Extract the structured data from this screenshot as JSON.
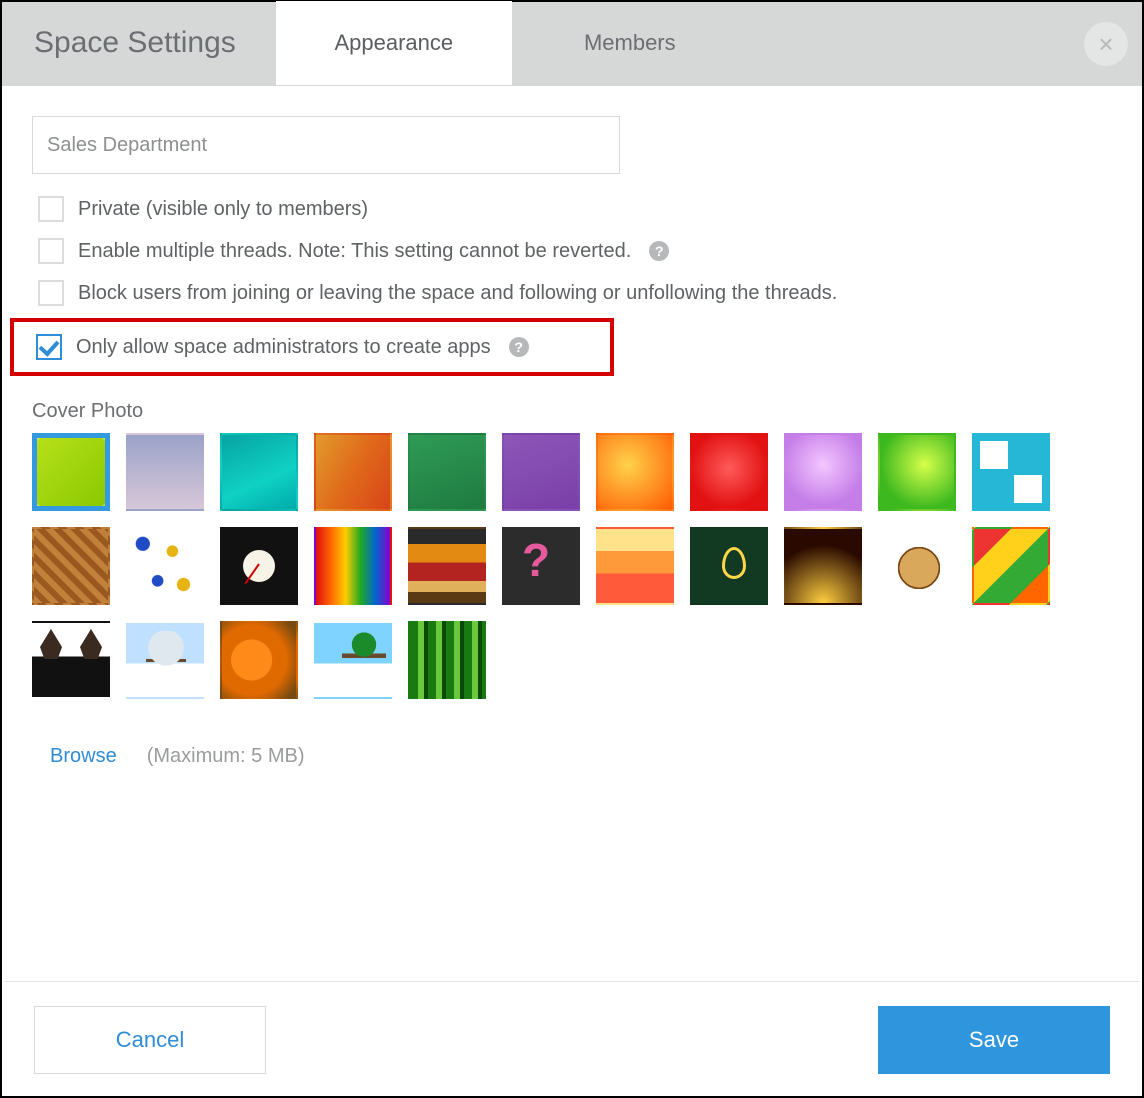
{
  "header": {
    "title": "Space Settings",
    "tabs": [
      {
        "label": "Appearance",
        "active": true
      },
      {
        "label": "Members",
        "active": false
      }
    ]
  },
  "form": {
    "space_name": "Sales Department",
    "checks": {
      "private": {
        "label": "Private (visible only to members)",
        "checked": false
      },
      "multi_thread": {
        "label": "Enable multiple threads. Note: This setting cannot be reverted.",
        "checked": false,
        "help": true
      },
      "block_users": {
        "label": "Block users from joining or leaving the space and following or unfollowing the threads.",
        "checked": false
      },
      "admin_only_apps": {
        "label": "Only allow space administrators to create apps",
        "checked": true,
        "help": true,
        "highlighted": true
      }
    }
  },
  "cover": {
    "label": "Cover Photo",
    "selected_index": 0,
    "count": 27,
    "browse_label": "Browse",
    "maxsize_label": "(Maximum: 5 MB)"
  },
  "footer": {
    "cancel": "Cancel",
    "save": "Save"
  }
}
